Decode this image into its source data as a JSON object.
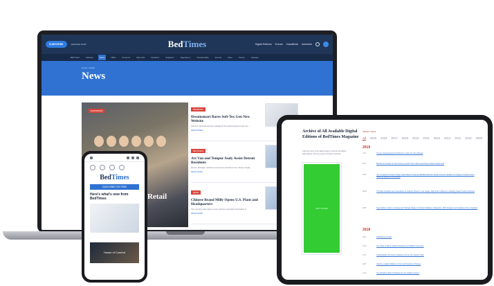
{
  "laptop": {
    "subscribe_label": "SUBSCRIBE",
    "top_small": "READING NOW",
    "logo": {
      "part1": "Bed",
      "part2": "Times"
    },
    "top_links": [
      "Digital Editions",
      "Events",
      "Classifieds",
      "Advertise"
    ],
    "nav_items": [
      "BETTALK",
      "Markets",
      "News",
      "DEIS",
      "Products",
      "Materials",
      "Retailers",
      "Suppliers",
      "Regulatory",
      "Sustainability",
      "Events",
      "Fairs",
      "Shows",
      "Lifestyle"
    ],
    "nav_active_index": 2,
    "breadcrumb": "Home > News",
    "page_title": "News",
    "featured": {
      "badge": "EXPANSION",
      "title_fragment": "s Retail"
    },
    "articles": [
      {
        "badge": "BRANDING",
        "title": "Dreamsmart Bares Soft-Tex Gen New Website",
        "snippet": "Soft-Tex International has redesigned the website dreamsmart.com...",
        "read_more": "READ MORE"
      },
      {
        "badge": "RETAILERS",
        "title": "Art Van and Tempur Sealy Assist Detroit Residents",
        "snippet": "Detroit, Michigan residents receive bed donations from Tempur Sealy...",
        "read_more": "READ MORE"
      },
      {
        "badge": "NEWS",
        "title": "Chinese Brand Milly Opens U.S. Plant and Headquarters",
        "snippet": "The company also plans a new mattress manufacturing facility in...",
        "read_more": "READ MORE"
      }
    ]
  },
  "phone": {
    "logo": {
      "part1": "Bed",
      "part2": "Times"
    },
    "banner": "SUBSCRIBE FOR FREE",
    "headline": "Here's what's new from BedTimes",
    "story_label": "House of Comfort"
  },
  "tablet": {
    "title": "Archive of All Available Digital Editions of BedTimes Magazine",
    "description": "Click the cover of the latest issue to view the full edition. Alternatively, click any year to browse its archive.",
    "cover_label": "PDF COVER",
    "year_label": "SELECT YEAR",
    "years": [
      "All",
      "2019",
      "2018",
      "2017",
      "2016",
      "2015",
      "2014",
      "2013",
      "2012",
      "2011",
      "2010",
      "2009"
    ],
    "year_selected_index": 0,
    "section_2019": "2019",
    "section_2018": "2018",
    "rows_2019": [
      {
        "month": "JUN",
        "title": "Tempur Sealy Expands Distribution Under Six New Brands"
      },
      {
        "month": "MAY",
        "title": "Brands Are Ready To Join Forces to Push Their Latest Launches & Drives Sales Now"
      },
      {
        "month": "APR",
        "title": "Our Complete Furniture Today Trade Report Featuring Bedding Brands, Retail Channel Updates & Category Growth Across Bedding Segments Worldwide"
      },
      {
        "month": "MAR",
        "title": "The Best Products and Innovations at Industry Shows in Las Vegas, High Point & Beyond, Including Sleep Product Partners"
      },
      {
        "month": "FEB",
        "title": "New Fabrics, Foams, Springs and Tickings Ready to Freshen Mattress Categories, With Designs and Guidance From Suppliers"
      }
    ],
    "rows_2018": [
      {
        "month": "DEC",
        "title": "2018 Buyers Guide"
      },
      {
        "month": "NOV",
        "title": "The State of Sleep Industry Retailing and Digital Commerce"
      },
      {
        "month": "OCT",
        "title": "Sustainability and Green Initiatives Across the Supply Chain"
      },
      {
        "month": "SEP",
        "title": "Industry Leaders Reflect on the Last Decade of Change"
      },
      {
        "month": "AUG",
        "title": "Top Retailers Share Strategies for the Holiday Season"
      }
    ]
  }
}
